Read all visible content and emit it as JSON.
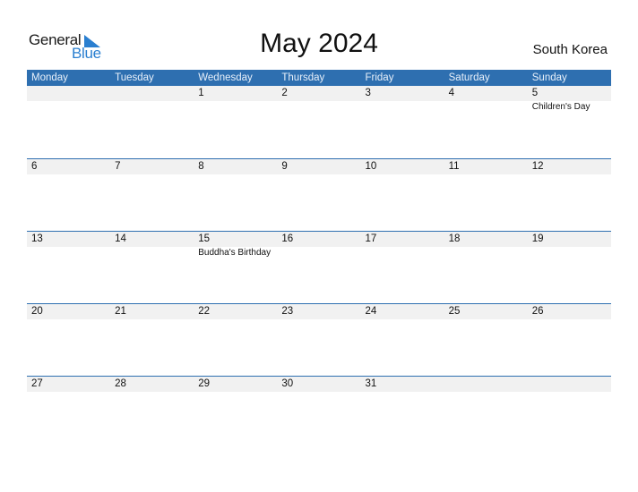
{
  "logo": {
    "part1": "General",
    "part2": "Blue"
  },
  "title": "May 2024",
  "country": "South Korea",
  "weekdays": [
    "Monday",
    "Tuesday",
    "Wednesday",
    "Thursday",
    "Friday",
    "Saturday",
    "Sunday"
  ],
  "weeks": [
    [
      {
        "day": "",
        "event": ""
      },
      {
        "day": "",
        "event": ""
      },
      {
        "day": "1",
        "event": ""
      },
      {
        "day": "2",
        "event": ""
      },
      {
        "day": "3",
        "event": ""
      },
      {
        "day": "4",
        "event": ""
      },
      {
        "day": "5",
        "event": "Children's Day"
      }
    ],
    [
      {
        "day": "6",
        "event": ""
      },
      {
        "day": "7",
        "event": ""
      },
      {
        "day": "8",
        "event": ""
      },
      {
        "day": "9",
        "event": ""
      },
      {
        "day": "10",
        "event": ""
      },
      {
        "day": "11",
        "event": ""
      },
      {
        "day": "12",
        "event": ""
      }
    ],
    [
      {
        "day": "13",
        "event": ""
      },
      {
        "day": "14",
        "event": ""
      },
      {
        "day": "15",
        "event": "Buddha's Birthday"
      },
      {
        "day": "16",
        "event": ""
      },
      {
        "day": "17",
        "event": ""
      },
      {
        "day": "18",
        "event": ""
      },
      {
        "day": "19",
        "event": ""
      }
    ],
    [
      {
        "day": "20",
        "event": ""
      },
      {
        "day": "21",
        "event": ""
      },
      {
        "day": "22",
        "event": ""
      },
      {
        "day": "23",
        "event": ""
      },
      {
        "day": "24",
        "event": ""
      },
      {
        "day": "25",
        "event": ""
      },
      {
        "day": "26",
        "event": ""
      }
    ],
    [
      {
        "day": "27",
        "event": ""
      },
      {
        "day": "28",
        "event": ""
      },
      {
        "day": "29",
        "event": ""
      },
      {
        "day": "30",
        "event": ""
      },
      {
        "day": "31",
        "event": ""
      },
      {
        "day": "",
        "event": ""
      },
      {
        "day": "",
        "event": ""
      }
    ]
  ],
  "colors": {
    "header_bg": "#2e6fb0",
    "logo_blue": "#2a7fd0",
    "strip_bg": "#f1f1f1"
  }
}
